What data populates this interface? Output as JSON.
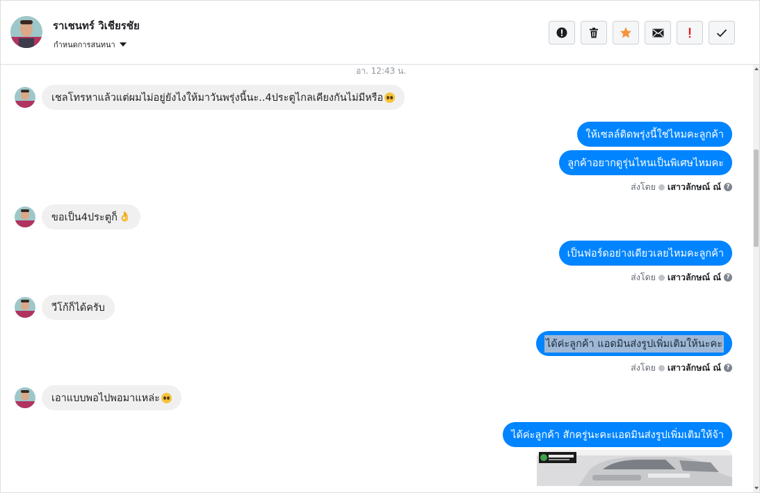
{
  "header": {
    "contact_name": "ราเชนทร์ วิเชียรชัย",
    "assign_label": "กำหนดการสนทนา",
    "actions": [
      {
        "icon": "alert-circle-icon",
        "name": "report-button"
      },
      {
        "icon": "trash-icon",
        "name": "delete-button"
      },
      {
        "icon": "star-icon",
        "name": "star-button"
      },
      {
        "icon": "mail-icon",
        "name": "mark-unread-button"
      },
      {
        "icon": "exclamation-icon",
        "name": "important-button"
      },
      {
        "icon": "check-icon",
        "name": "done-button"
      }
    ]
  },
  "conversation": {
    "timestamp": "อา. 12:43 น.",
    "messages": [
      {
        "direction": "in",
        "text": "เชลโทรหาแล้วแต่ผมไม่อยู่ยังไงให้มาวันพรุ่งนี้นะ..4ประตูไกลเคียงกันไม่มีหรือ",
        "emoji": "pleading-face-icon"
      },
      {
        "direction": "out",
        "text": "ให้เซลล์ติดพรุ่งนี้ใช่ไหมคะลูกค้า"
      },
      {
        "direction": "out",
        "text": "ลูกค้าอยากดูรุ่นไหนเป็นพิเศษไหมคะ"
      },
      {
        "direction": "in",
        "text": "ขอเป็น4ประตูก็",
        "emoji": "ok-hand-icon"
      },
      {
        "direction": "out",
        "text": "เป็นฟอร์ดอย่างเดียวเลยไหมคะลูกค้า"
      },
      {
        "direction": "in",
        "text": "วีโก้ก็ได้ครับ"
      },
      {
        "direction": "out",
        "text": "ได้ค่ะลูกค้า แอดมินส่งรูปเพิ่มเติมให้นะคะ",
        "selected": true
      },
      {
        "direction": "in",
        "text": "เอาแบบพอไปพอมาแหล่ะ",
        "emoji": "pleading-face-icon"
      },
      {
        "direction": "out",
        "text": "ได้ค่ะลูกค้า สักครู่นะคะแอดมินส่งรูปเพิ่มเติมให้จ้า"
      }
    ],
    "sent_by_prefix": "ส่งโดย",
    "sent_by_name": "เสาวลักษณ์ ณ์"
  },
  "colors": {
    "outgoing_bubble": "#0084ff",
    "incoming_bubble": "#f1f0f0",
    "star": "#f7923b",
    "important": "#e02020"
  }
}
